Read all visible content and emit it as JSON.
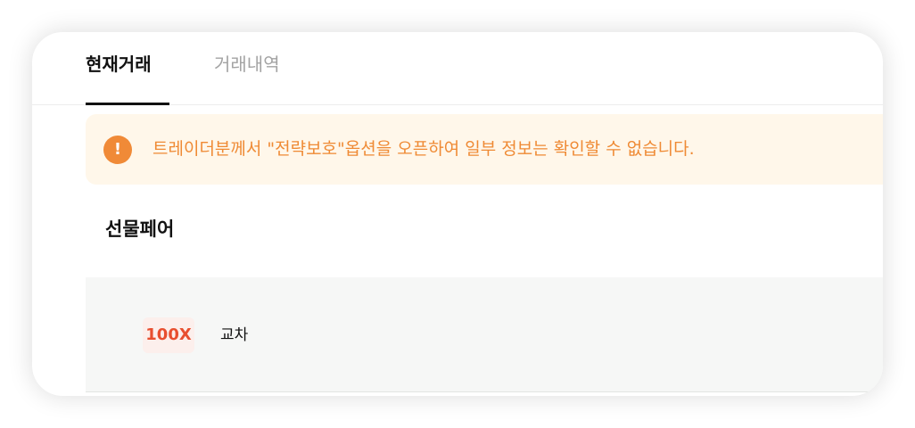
{
  "tabs": {
    "active": "현재거래",
    "inactive": "거래내역"
  },
  "notice": {
    "icon": "exclamation-icon",
    "icon_glyph": "!",
    "text": "트레이더분께서 \"전략보호\"옵션을 오픈하여 일부 정보는 확인할 수 없습니다.",
    "color": "#ef8a34",
    "background": "#fff7ea"
  },
  "section": {
    "title": "선물페어"
  },
  "row": {
    "leverage": "100X",
    "margin_mode": "교차"
  }
}
